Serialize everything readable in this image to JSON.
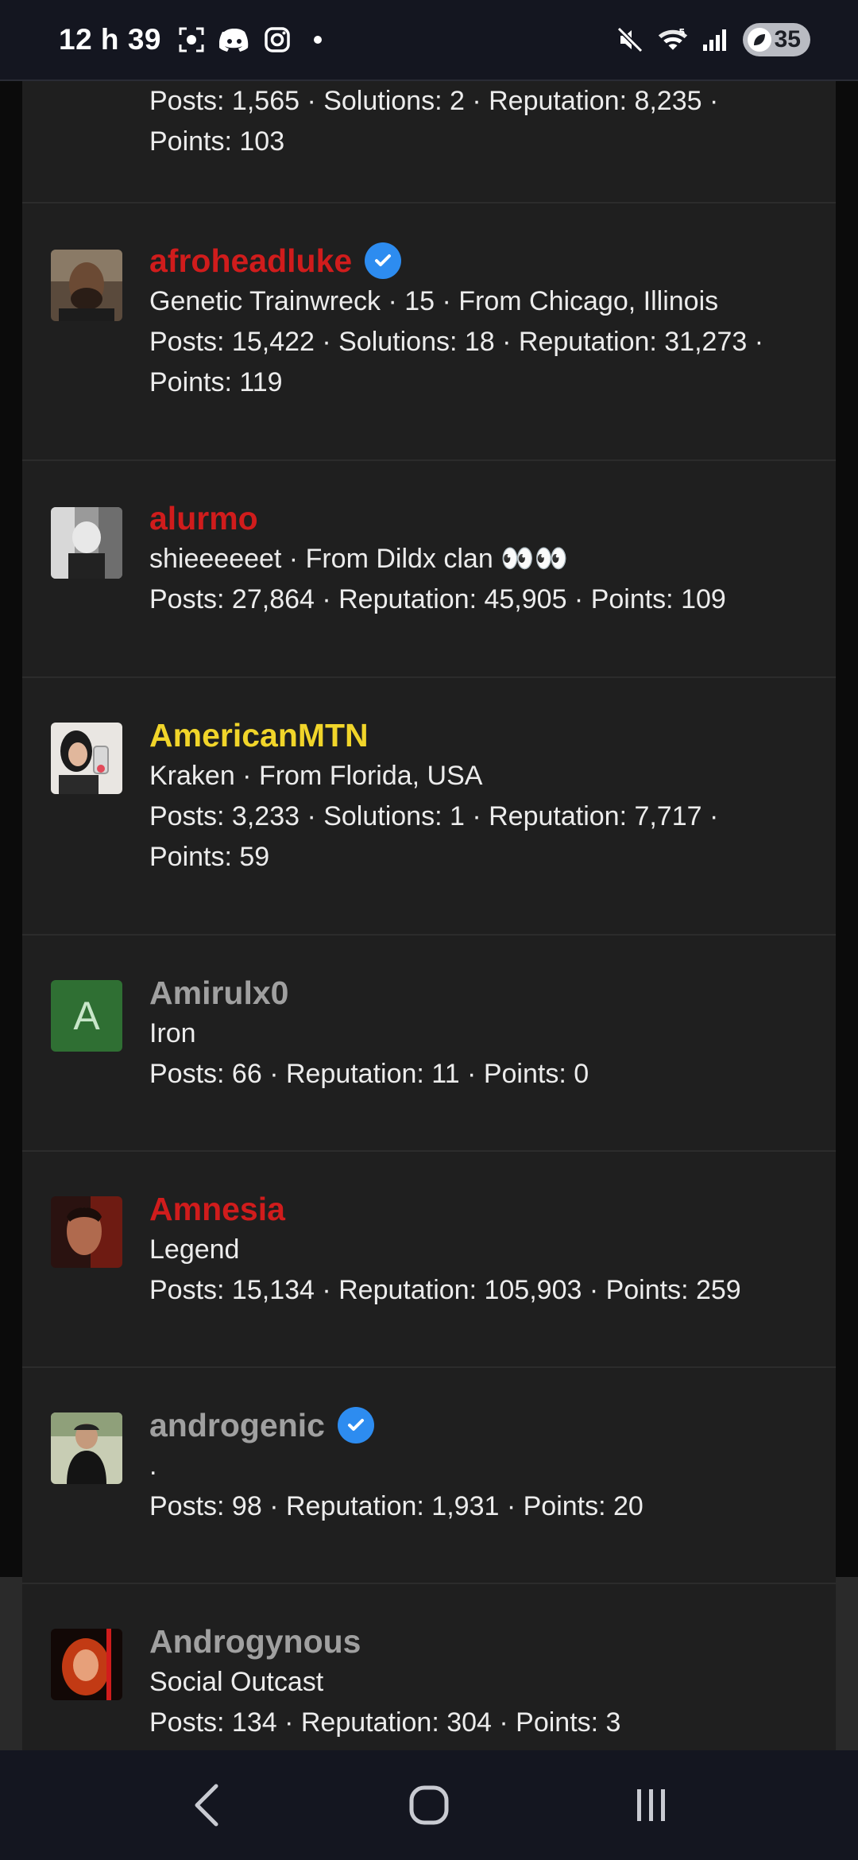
{
  "status": {
    "time": "12 h 39",
    "battery": "35"
  },
  "members": [
    {
      "name": "",
      "stats": "Posts: 1,565 · Solutions: 2 · Reputation: 8,235 ·",
      "stats2": "Points: 103"
    },
    {
      "name": "afroheadluke",
      "verified": true,
      "title": "Genetic Trainwreck · 15 · From Chicago, Illinois",
      "stats": "Posts: 15,422 · Solutions: 18 · Reputation: 31,273 ·",
      "stats2": "Points: 119",
      "name_color": "#d01c1c"
    },
    {
      "name": "alurmo",
      "title": "shieeeeeet · From Dildx clan 👀👀",
      "stats": "Posts: 27,864 · Reputation: 45,905 · Points: 109",
      "name_color": "#d01c1c"
    },
    {
      "name": "AmericanMTN",
      "title": "Kraken · From Florida, USA",
      "stats": "Posts: 3,233 · Solutions: 1 · Reputation: 7,717 ·",
      "stats2": "Points: 59",
      "name_color": "#f1d52a"
    },
    {
      "name": "Amirulx0",
      "avatar_letter": "A",
      "title": "Iron",
      "stats": "Posts: 66 · Reputation: 11 · Points: 0",
      "name_color": "#a0a0a0"
    },
    {
      "name": "Amnesia",
      "title": "Legend",
      "stats": "Posts: 15,134 · Reputation: 105,903 · Points: 259",
      "name_color": "#d01c1c"
    },
    {
      "name": "androgenic",
      "verified": true,
      "title": ".",
      "stats": "Posts: 98 · Reputation: 1,931 · Points: 20",
      "name_color": "#a0a0a0"
    },
    {
      "name": "Androgynous",
      "title": "Social Outcast",
      "stats": "Posts: 134 · Reputation: 304 · Points: 3",
      "name_color": "#a0a0a0"
    }
  ],
  "nav": {
    "back_icon": "back-chevron-icon",
    "home_icon": "home-circle-icon",
    "recents_icon": "recents-bars-icon"
  }
}
